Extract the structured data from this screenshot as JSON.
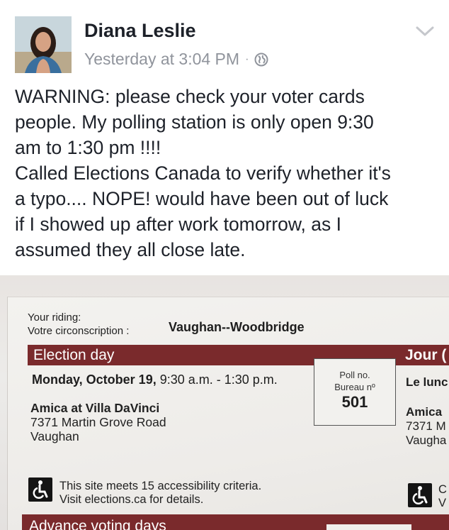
{
  "post": {
    "author": "Diana Leslie",
    "timestamp": "Yesterday at 3:04 PM",
    "separator": "·",
    "privacy_icon": "globe-icon",
    "menu_icon": "chevron-down-icon",
    "text_lines": [
      "WARNING: please check your voter cards",
      "people. My polling station is only open 9:30",
      "am to 1:30 pm !!!!",
      "Called Elections Canada to verify whether it's",
      "a typo.... NOPE! would have been out of luck",
      "if I showed up after work tomorrow, as I",
      "assumed they all close late."
    ]
  },
  "card": {
    "riding_label_en": "Your riding:",
    "riding_label_fr": "Votre circonscription :",
    "riding_value": "Vaughan--Woodbridge",
    "band_title": "Election day",
    "band_title_fr": "Jour (",
    "date_bold": "Monday, October 19,",
    "date_hours": " 9:30 a.m. - 1:30 p.m.",
    "poll_label_en": "Poll no.",
    "poll_label_fr": "Bureau nº",
    "poll_number": "501",
    "location_name": "Amica at Villa DaVinci",
    "location_street": "7371 Martin Grove Road",
    "location_city": "Vaughan",
    "fr_date": "Le lunc",
    "fr_location_name": "Amica",
    "fr_location_street": "7371 M",
    "fr_location_city": "Vaugha",
    "access_line1": "This site meets 15 accessibility criteria.",
    "access_line2": "Visit elections.ca for details.",
    "access_fr_line1": "C",
    "access_fr_line2": "V",
    "advance_title": "Advance voting days",
    "accessibility_icon": "wheelchair-icon"
  },
  "colors": {
    "band": "#7a2a2c",
    "author": "#1d2129",
    "meta": "#90949c"
  }
}
